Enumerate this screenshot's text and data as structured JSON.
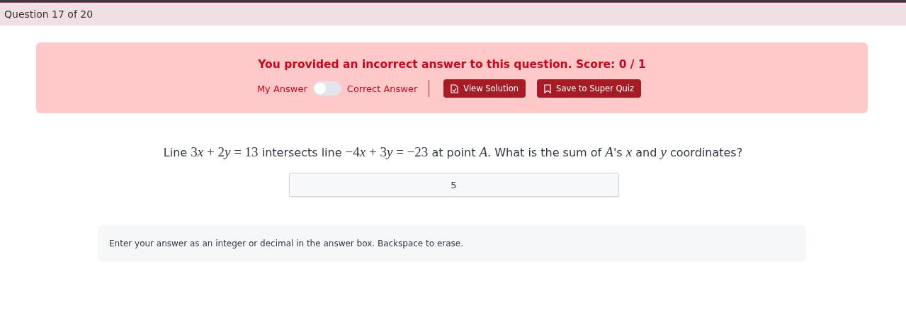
{
  "header": {
    "title": "Question 17 of 20"
  },
  "feedback": {
    "message": "You provided an incorrect answer to this question. Score: 0 / 1",
    "toggle": {
      "left_label": "My Answer",
      "right_label": "Correct Answer",
      "on": false
    },
    "buttons": [
      {
        "kind": "solution",
        "label": "View Solution"
      },
      {
        "kind": "save",
        "label": "Save to Super Quiz"
      }
    ]
  },
  "question": [
    {
      "kind": "text",
      "text": "Line "
    },
    {
      "kind": "math",
      "text": "3"
    },
    {
      "kind": "var",
      "text": "x"
    },
    {
      "kind": "math",
      "text": " + 2"
    },
    {
      "kind": "var",
      "text": "y"
    },
    {
      "kind": "math",
      "text": " = 13"
    },
    {
      "kind": "text",
      "text": " intersects line "
    },
    {
      "kind": "math",
      "text": "−4"
    },
    {
      "kind": "var",
      "text": "x"
    },
    {
      "kind": "math",
      "text": " + 3"
    },
    {
      "kind": "var",
      "text": "y"
    },
    {
      "kind": "math",
      "text": " = −23"
    },
    {
      "kind": "text",
      "text": " at point "
    },
    {
      "kind": "var",
      "text": "A"
    },
    {
      "kind": "text",
      "text": ". What is the sum of "
    },
    {
      "kind": "var",
      "text": "A"
    },
    {
      "kind": "text",
      "text": "'s "
    },
    {
      "kind": "var",
      "text": "x"
    },
    {
      "kind": "text",
      "text": " and "
    },
    {
      "kind": "var",
      "text": "y"
    },
    {
      "kind": "text",
      "text": " coordinates?"
    }
  ],
  "answer": {
    "value": "5"
  },
  "hint": "Enter your answer as an integer or decimal in the answer box. Backspace to erase."
}
